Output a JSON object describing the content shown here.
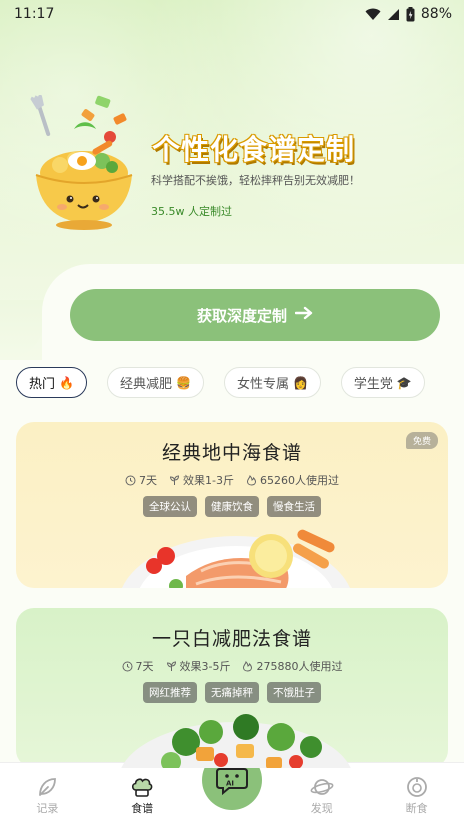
{
  "status_bar": {
    "time": "11:17",
    "battery": "88%"
  },
  "hero": {
    "title": "个性化食谱定制",
    "subtitle": "科学搭配不挨饿，轻松摔秤告别无效减肥！",
    "count": "35.5w 人定制过",
    "cta_label": "获取深度定制"
  },
  "chips": [
    {
      "label": "热门",
      "emoji": "🔥"
    },
    {
      "label": "经典减肥",
      "emoji": "🍔"
    },
    {
      "label": "女性专属",
      "emoji": "👩"
    },
    {
      "label": "学生党",
      "emoji": "🎓"
    }
  ],
  "cards": [
    {
      "title": "经典地中海食谱",
      "badge": "免费",
      "days": "7天",
      "effect": "效果1-3斤",
      "users": "65260人使用过",
      "tags": [
        "全球公认",
        "健康饮食",
        "慢食生活"
      ]
    },
    {
      "title": "一只白减肥法食谱",
      "days": "7天",
      "effect": "效果3-5斤",
      "users": "275880人使用过",
      "tags": [
        "网红推荐",
        "无痛掉秤",
        "不饿肚子"
      ]
    }
  ],
  "nav": {
    "items": [
      {
        "label": "记录",
        "icon": "leaf-icon"
      },
      {
        "label": "食谱",
        "icon": "chef-hat-icon"
      },
      {
        "label": "发现",
        "icon": "planet-icon"
      },
      {
        "label": "断食",
        "icon": "timer-icon"
      }
    ],
    "active": "食谱",
    "ai_label": "AI"
  },
  "colors": {
    "accent_green": "#8bc17a",
    "title_gold": "#d99a00",
    "card1_bg": "#fbf0c4",
    "card2_bg": "#d8f2c8"
  }
}
